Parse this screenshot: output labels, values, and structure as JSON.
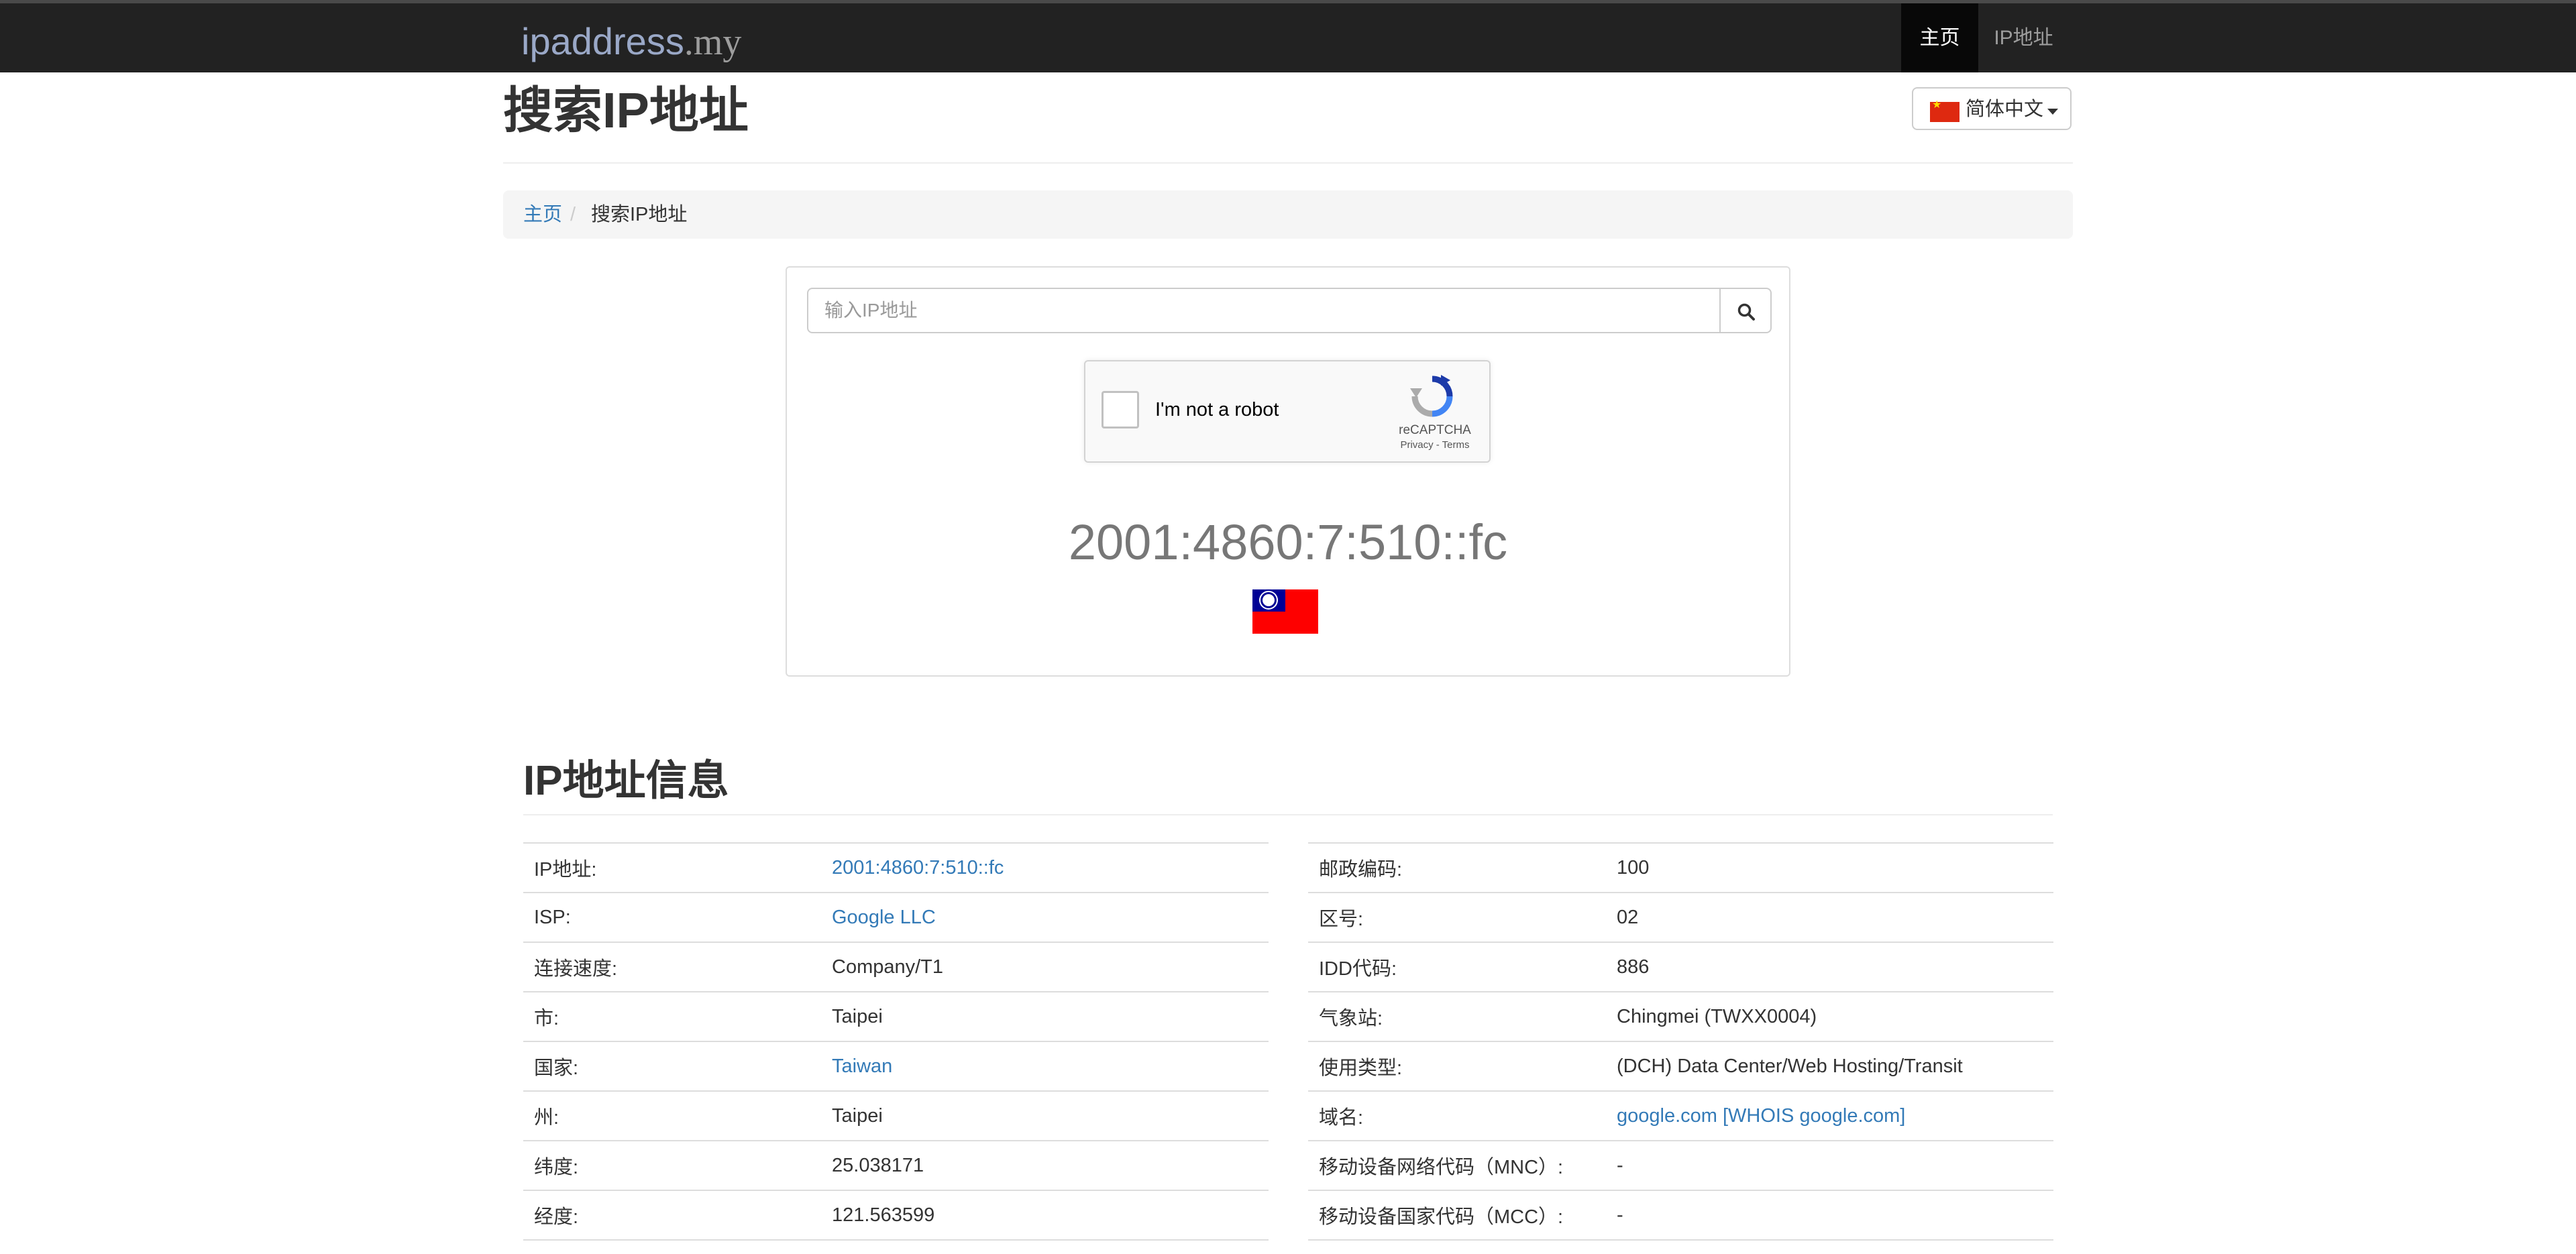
{
  "navbar": {
    "brand_main": "ipaddress",
    "brand_tld": ".my",
    "items": [
      {
        "label": "主页",
        "active": true
      },
      {
        "label": "IP地址",
        "active": false
      }
    ]
  },
  "header": {
    "title": "搜索IP地址",
    "language": {
      "label": "简体中文",
      "flag": "cn-flag"
    }
  },
  "breadcrumb": {
    "home": "主页",
    "separator": "/",
    "current": "搜索IP地址"
  },
  "search": {
    "placeholder": "输入IP地址",
    "value": "",
    "button_icon": "search-icon"
  },
  "recaptcha": {
    "label": "I'm not a robot",
    "brand": "reCAPTCHA",
    "links": "Privacy - Terms",
    "checked": false
  },
  "result": {
    "ip": "2001:4860:7:510::fc",
    "flag": "taiwan-flag"
  },
  "info": {
    "title": "IP地址信息",
    "left": [
      {
        "label": "IP地址:",
        "value": "2001:4860:7:510::fc",
        "link": true
      },
      {
        "label": "ISP:",
        "value": "Google LLC",
        "link": true
      },
      {
        "label": "连接速度:",
        "value": "Company/T1",
        "link": false
      },
      {
        "label": "市:",
        "value": "Taipei",
        "link": false
      },
      {
        "label": "国家:",
        "value": "Taiwan",
        "link": true
      },
      {
        "label": "州:",
        "value": "Taipei",
        "link": false
      },
      {
        "label": "纬度:",
        "value": "25.038171",
        "link": false
      },
      {
        "label": "经度:",
        "value": "121.563599",
        "link": false
      }
    ],
    "right": [
      {
        "label": "邮政编码:",
        "value": "100",
        "link": false
      },
      {
        "label": "区号:",
        "value": "02",
        "link": false
      },
      {
        "label": "IDD代码:",
        "value": "886",
        "link": false
      },
      {
        "label": "气象站:",
        "value": "Chingmei (TWXX0004)",
        "link": false
      },
      {
        "label": "使用类型:",
        "value": "(DCH) Data Center/Web Hosting/Transit",
        "link": false
      },
      {
        "label": "域名:",
        "value": "google.com [WHOIS google.com]",
        "link": true
      },
      {
        "label": "移动设备网络代码（MNC）:",
        "value": "-",
        "link": false
      },
      {
        "label": "移动设备国家代码（MCC）:",
        "value": "-",
        "link": false
      }
    ]
  },
  "colors": {
    "navbar_bg": "#222222",
    "link": "#337ab7",
    "muted_text": "#777777"
  }
}
